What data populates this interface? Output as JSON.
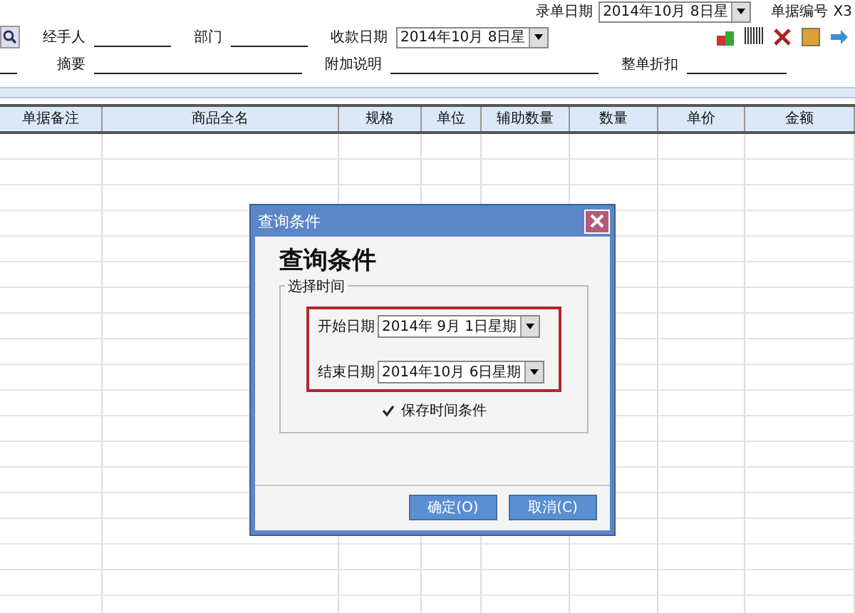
{
  "header": {
    "top_fields": [
      {
        "label": "录单日期",
        "value": "2014年10月 8日星"
      },
      {
        "label": "单据编号",
        "value": "X3"
      }
    ],
    "row1": [
      {
        "label": "经手人",
        "kind": "line"
      },
      {
        "label": "部门",
        "kind": "line"
      },
      {
        "label": "收款日期",
        "kind": "combo",
        "value": "2014年10月  8日星"
      }
    ],
    "row2": [
      {
        "label": "摘要",
        "kind": "line"
      },
      {
        "label": "附加说明",
        "kind": "line"
      },
      {
        "label": "整单折扣",
        "kind": "line"
      }
    ]
  },
  "table": {
    "columns": [
      "单据备注",
      "商品全名",
      "规格",
      "单位",
      "辅助数量",
      "数量",
      "单价",
      "金额"
    ]
  },
  "dialog": {
    "title": "查询条件",
    "heading": "查询条件",
    "group": "选择时间",
    "dates": [
      {
        "label": "开始日期",
        "value": "2014年  9月  1日星期"
      },
      {
        "label": "结束日期",
        "value": "2014年10月  6日星期"
      }
    ],
    "save_option": {
      "label": "保存时间条件",
      "checked": true
    },
    "buttons": [
      "确定(O)",
      "取消(C)"
    ]
  }
}
